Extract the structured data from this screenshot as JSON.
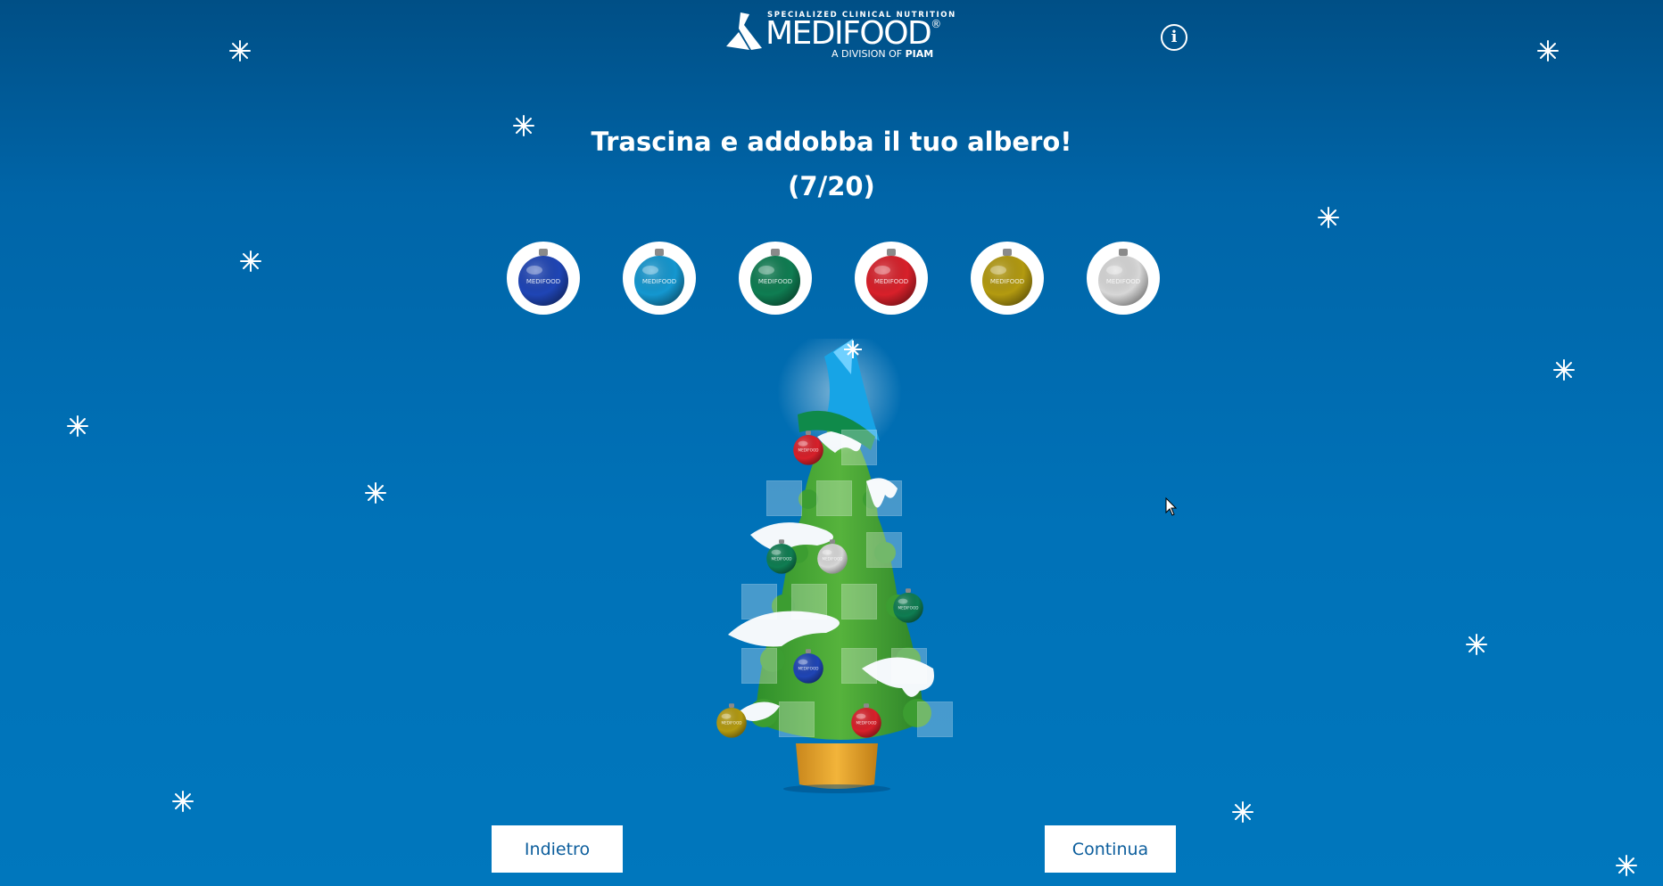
{
  "header": {
    "logo_tagline": "SPECIALIZED CLINICAL NUTRITION",
    "logo_brand": "MEDIFOOD",
    "logo_registered": "®",
    "logo_division_prefix": "A DIVISION OF ",
    "logo_division_name": "PIAM",
    "info_icon": "info-circle-icon"
  },
  "game": {
    "title": "Trascina e addobba il tuo albero!",
    "progress": "(7/20)",
    "placed_count": 7,
    "total_slots": 20,
    "palette": [
      {
        "name": "dark-blue",
        "color": "#1f45b5"
      },
      {
        "name": "light-blue",
        "color": "#1497d0"
      },
      {
        "name": "green",
        "color": "#0f7d52"
      },
      {
        "name": "red",
        "color": "#d8202a"
      },
      {
        "name": "gold",
        "color": "#b39a10"
      },
      {
        "name": "silver",
        "color": "#d7d7d7"
      }
    ],
    "ornament_label": "MEDIFOOD"
  },
  "buttons": {
    "back": "Indietro",
    "continue": "Continua"
  }
}
